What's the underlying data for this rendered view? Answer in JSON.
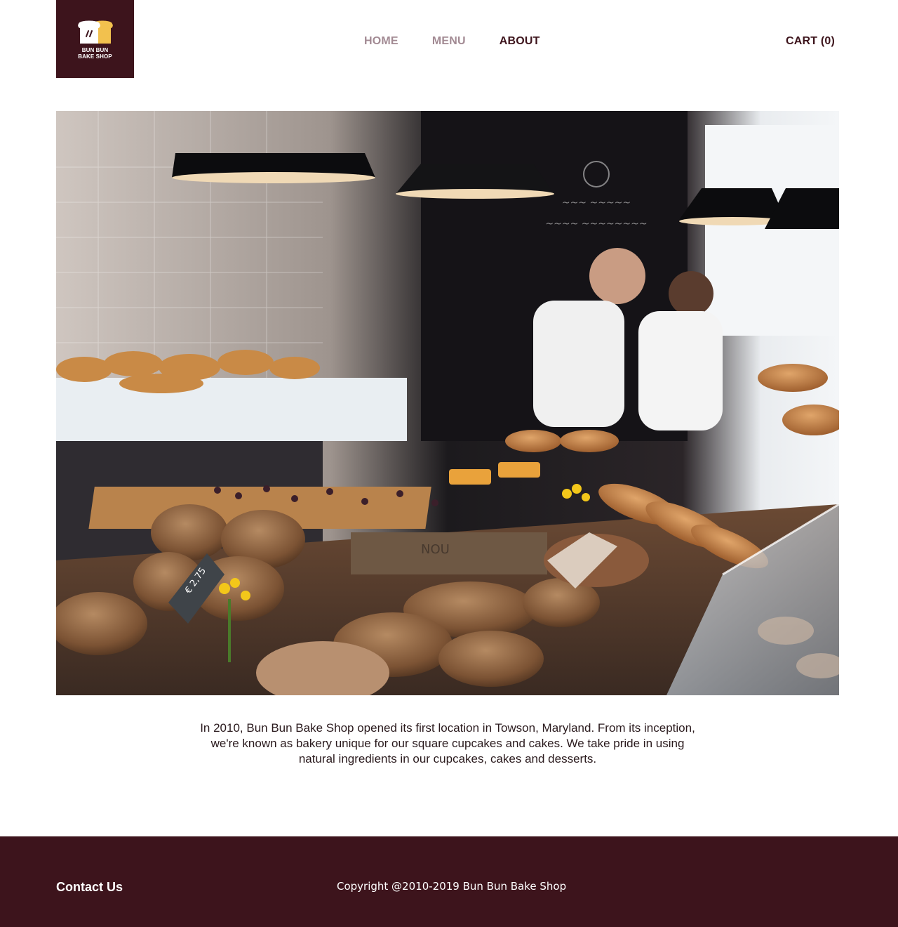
{
  "header": {
    "logo": {
      "icon": "bread-slices-icon",
      "line1": "BUN BUN",
      "line2": "BAKE SHOP"
    },
    "nav": [
      {
        "label": "HOME",
        "active": false
      },
      {
        "label": "MENU",
        "active": false
      },
      {
        "label": "ABOUT",
        "active": true
      }
    ],
    "cart_label": "CART (0)"
  },
  "hero": {
    "image": "bakery-counter-photo"
  },
  "about": {
    "text": "In 2010, Bun Bun Bake Shop opened its first location in Towson, Maryland. From its inception, we're known as bakery unique for our square cupcakes and cakes. We take pride in using natural ingredients in our cupcakes, cakes and desserts."
  },
  "footer": {
    "contact_label": "Contact Us",
    "copyright": "Copyright @2010-2019 Bun Bun Bake Shop"
  },
  "colors": {
    "brand": "#3d141c",
    "nav_inactive": "#a28a93",
    "logo_accent": "#f2c14e"
  }
}
